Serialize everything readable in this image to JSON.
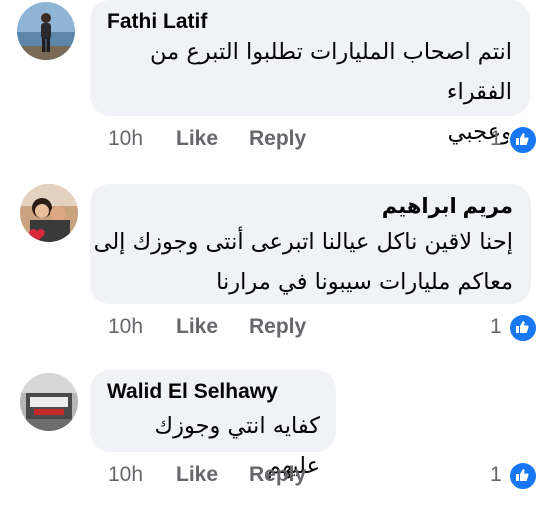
{
  "comments": [
    {
      "author": "Fathi Latif",
      "lines": [
        "انتم اصحاب المليارات تطلبوا التبرع من الفقراء",
        "وعجبي"
      ],
      "time": "10h",
      "like_label": "Like",
      "reply_label": "Reply",
      "reaction_count": "1",
      "reaction_icon": "thumbs-up-icon"
    },
    {
      "author": "مريم ابراهيم",
      "lines": [
        "إحنا لاقين ناكل عيالنا اتبرعى أنتى وجوزك إلى",
        "معاكم مليارات سيبونا في مرارنا"
      ],
      "time": "10h",
      "like_label": "Like",
      "reply_label": "Reply",
      "reaction_count": "1",
      "reaction_icon": "thumbs-up-icon"
    },
    {
      "author": "Walid El Selhawy",
      "lines": [
        "كفايه انتي وجوزك عليهم"
      ],
      "time": "10h",
      "like_label": "Like",
      "reply_label": "Reply",
      "reaction_count": "1",
      "reaction_icon": "thumbs-up-icon"
    }
  ],
  "colors": {
    "bubble": "#f0f2f5",
    "text": "#050505",
    "secondary": "#65676b",
    "like_blue": "#1877f2"
  }
}
